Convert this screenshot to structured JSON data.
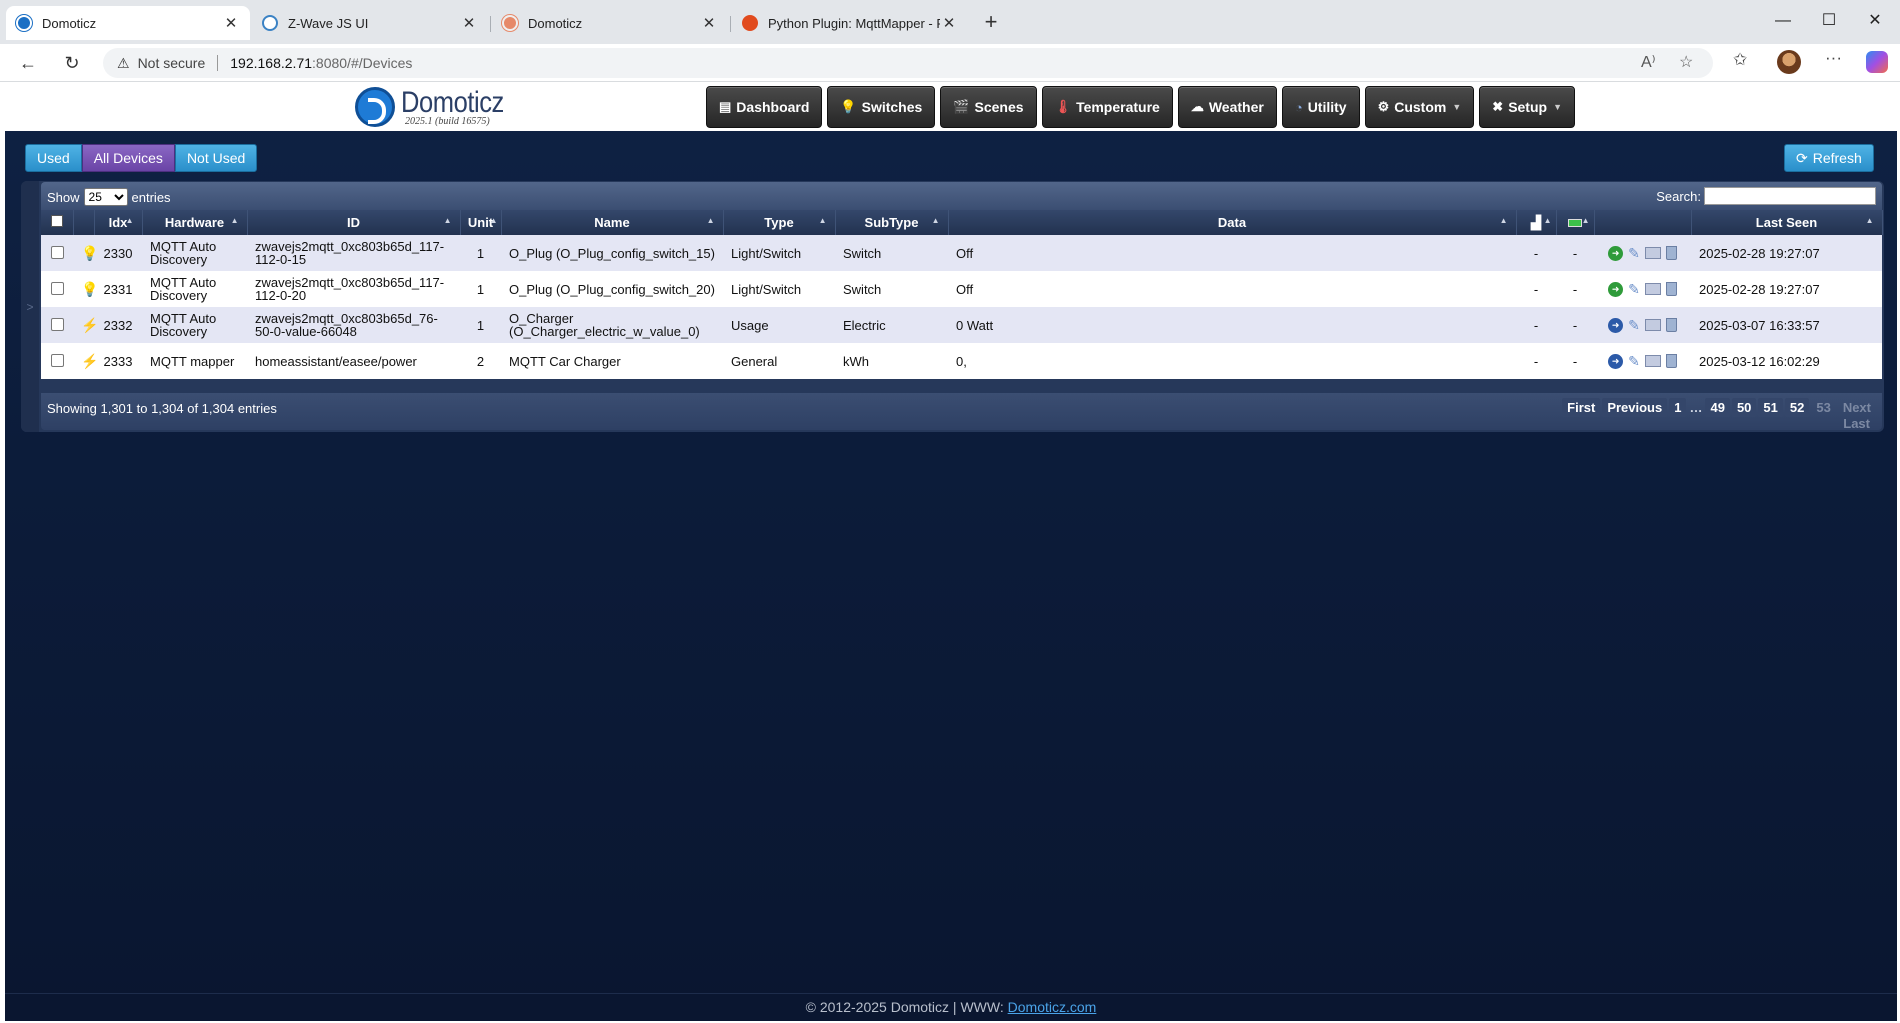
{
  "browser": {
    "tabs": [
      {
        "title": "Domoticz",
        "active": true,
        "favicon": "domoticz-icon"
      },
      {
        "title": "Z-Wave JS UI",
        "active": false,
        "favicon": "zwave-icon"
      },
      {
        "title": "Domoticz",
        "active": false,
        "favicon": "domoticz-icon"
      },
      {
        "title": "Python Plugin: MqttMapper - Pag",
        "active": false,
        "favicon": "python-icon"
      }
    ],
    "address": {
      "security": "Not secure",
      "host": "192.168.2.71",
      "path": ":8080/#/Devices"
    }
  },
  "app": {
    "logo_text": "Domoticz",
    "version": "2025.1 (build 16575)",
    "nav": [
      {
        "label": "Dashboard",
        "icon": "dashboard-icon"
      },
      {
        "label": "Switches",
        "icon": "bulb-icon"
      },
      {
        "label": "Scenes",
        "icon": "scenes-icon"
      },
      {
        "label": "Temperature",
        "icon": "thermometer-icon"
      },
      {
        "label": "Weather",
        "icon": "weather-icon"
      },
      {
        "label": "Utility",
        "icon": "utility-icon"
      },
      {
        "label": "Custom",
        "icon": "gear-icon",
        "dropdown": true
      },
      {
        "label": "Setup",
        "icon": "tools-icon",
        "dropdown": true
      }
    ]
  },
  "filters": {
    "used": "Used",
    "all": "All Devices",
    "not_used": "Not Used",
    "selected": "All Devices"
  },
  "refresh_label": "Refresh",
  "table": {
    "show_label": "Show",
    "page_size": "25",
    "entries_label": "entries",
    "search_label": "Search:",
    "search_value": "",
    "columns": {
      "idx": "Idx",
      "hardware": "Hardware",
      "id": "ID",
      "unit": "Unit",
      "name": "Name",
      "type": "Type",
      "subtype": "SubType",
      "data": "Data",
      "last_seen": "Last Seen"
    },
    "rows": [
      {
        "idx": "2330",
        "hardware": "MQTT Auto Discovery",
        "id": "zwavejs2mqtt_0xc803b65d_117-112-0-15",
        "unit": "1",
        "name": "O_Plug (O_Plug_config_switch_15)",
        "type": "Light/Switch",
        "subtype": "Switch",
        "data": "Off",
        "signal": "-",
        "battery": "-",
        "last_seen": "2025-02-28 19:27:07",
        "icon": "bulb-icon",
        "action": "add-device-icon"
      },
      {
        "idx": "2331",
        "hardware": "MQTT Auto Discovery",
        "id": "zwavejs2mqtt_0xc803b65d_117-112-0-20",
        "unit": "1",
        "name": "O_Plug (O_Plug_config_switch_20)",
        "type": "Light/Switch",
        "subtype": "Switch",
        "data": "Off",
        "signal": "-",
        "battery": "-",
        "last_seen": "2025-02-28 19:27:07",
        "icon": "bulb-icon",
        "action": "add-device-icon"
      },
      {
        "idx": "2332",
        "hardware": "MQTT Auto Discovery",
        "id": "zwavejs2mqtt_0xc803b65d_76-50-0-value-66048",
        "unit": "1",
        "name": "O_Charger (O_Charger_electric_w_value_0)",
        "type": "Usage",
        "subtype": "Electric",
        "data": "0 Watt",
        "signal": "-",
        "battery": "-",
        "last_seen": "2025-03-07 16:33:57",
        "icon": "bolt-icon",
        "action": "remove-device-icon"
      },
      {
        "idx": "2333",
        "hardware": "MQTT mapper",
        "id": "homeassistant/easee/power",
        "unit": "2",
        "name": "MQTT Car Charger",
        "type": "General",
        "subtype": "kWh",
        "data": "0,",
        "signal": "-",
        "battery": "-",
        "last_seen": "2025-03-12 16:02:29",
        "icon": "bolt-icon",
        "action": "remove-device-icon"
      }
    ],
    "info": "Showing 1,301 to 1,304 of 1,304 entries",
    "pager": {
      "first": "First",
      "previous": "Previous",
      "pages": [
        "1",
        "…",
        "49",
        "50",
        "51",
        "52",
        "53"
      ],
      "current": "53",
      "next": "Next",
      "last": "Last"
    }
  },
  "footer": {
    "text": "© 2012-2025 Domoticz | WWW: ",
    "link": "Domoticz.com"
  }
}
